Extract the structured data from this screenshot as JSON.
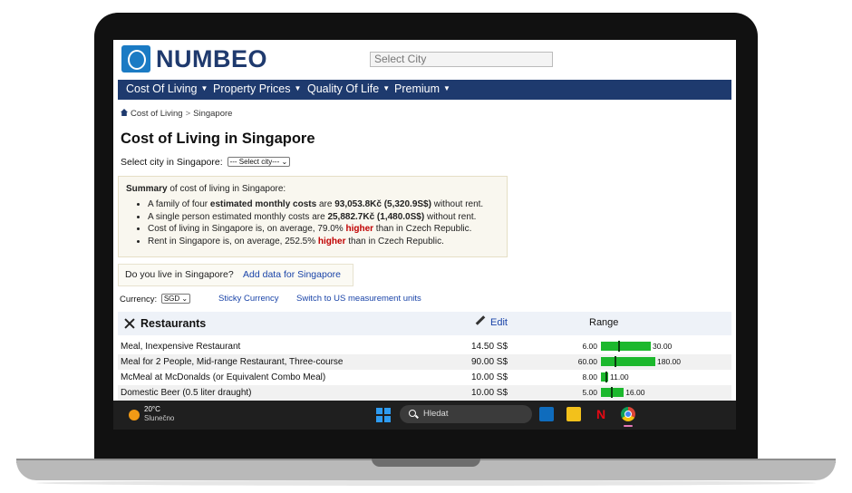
{
  "header": {
    "logo_text": "NUMBEO",
    "select_city_placeholder": "Select City"
  },
  "nav": {
    "items": [
      {
        "label": "Cost Of Living"
      },
      {
        "label": "Property Prices"
      },
      {
        "label": "Quality Of Life"
      },
      {
        "label": "Premium"
      }
    ]
  },
  "breadcrumb": {
    "items": [
      "Cost of Living",
      "Singapore"
    ],
    "separator": ">"
  },
  "page": {
    "title": "Cost of Living in Singapore",
    "select_city_label": "Select city in Singapore:",
    "select_city_value": "--- Select city---"
  },
  "summary": {
    "heading_bold": "Summary",
    "heading_rest": " of cost of living in Singapore:",
    "items": [
      {
        "pre": "A family of four ",
        "bold1": "estimated monthly costs",
        "mid": " are ",
        "bold2": "93,053.8Kč (5,320.9S$)",
        "post": " without rent."
      },
      {
        "pre": "A single person estimated monthly costs are ",
        "bold2": "25,882.7Kč (1,480.0S$)",
        "post": " without rent."
      },
      {
        "pre": "Cost of living in Singapore is, on average, 79.0% ",
        "highlight": "higher",
        "post": " than in Czech Republic."
      },
      {
        "pre": "Rent in Singapore is, on average, 252.5% ",
        "highlight": "higher",
        "post": " than in Czech Republic."
      }
    ]
  },
  "live_box": {
    "question": "Do you live in Singapore?",
    "link": "Add data for Singapore"
  },
  "currency": {
    "label": "Currency:",
    "value": "SGD",
    "sticky_link": "Sticky Currency",
    "units_link": "Switch to US measurement units"
  },
  "restaurants": {
    "title": "Restaurants",
    "edit_label": "Edit",
    "range_label": "Range",
    "rows": [
      {
        "name": "Meal, Inexpensive Restaurant",
        "price": "14.50 S$",
        "min": "6.00",
        "max": "30.00",
        "min_val": 6.0,
        "max_val": 30.0,
        "avg_val": 14.5
      },
      {
        "name": "Meal for 2 People, Mid-range Restaurant, Three-course",
        "price": "90.00 S$",
        "min": "60.00",
        "max": "180.00",
        "min_val": 60.0,
        "max_val": 180.0,
        "avg_val": 90.0
      },
      {
        "name": "McMeal at McDonalds (or Equivalent Combo Meal)",
        "price": "10.00 S$",
        "min": "8.00",
        "max": "11.00",
        "min_val": 8.0,
        "max_val": 11.0,
        "avg_val": 10.0
      },
      {
        "name": "Domestic Beer (0.5 liter draught)",
        "price": "10.00 S$",
        "min": "5.00",
        "max": "16.00",
        "min_val": 5.0,
        "max_val": 16.0,
        "avg_val": 10.0
      }
    ]
  },
  "taskbar": {
    "temperature": "20°C",
    "condition": "Slunečno",
    "search_label": "Hledat",
    "netflix_glyph": "N"
  },
  "colors": {
    "nav_bg": "#1e3a6e",
    "link": "#1a44a8",
    "higher": "#c00000",
    "range_bar": "#1cb82d"
  }
}
